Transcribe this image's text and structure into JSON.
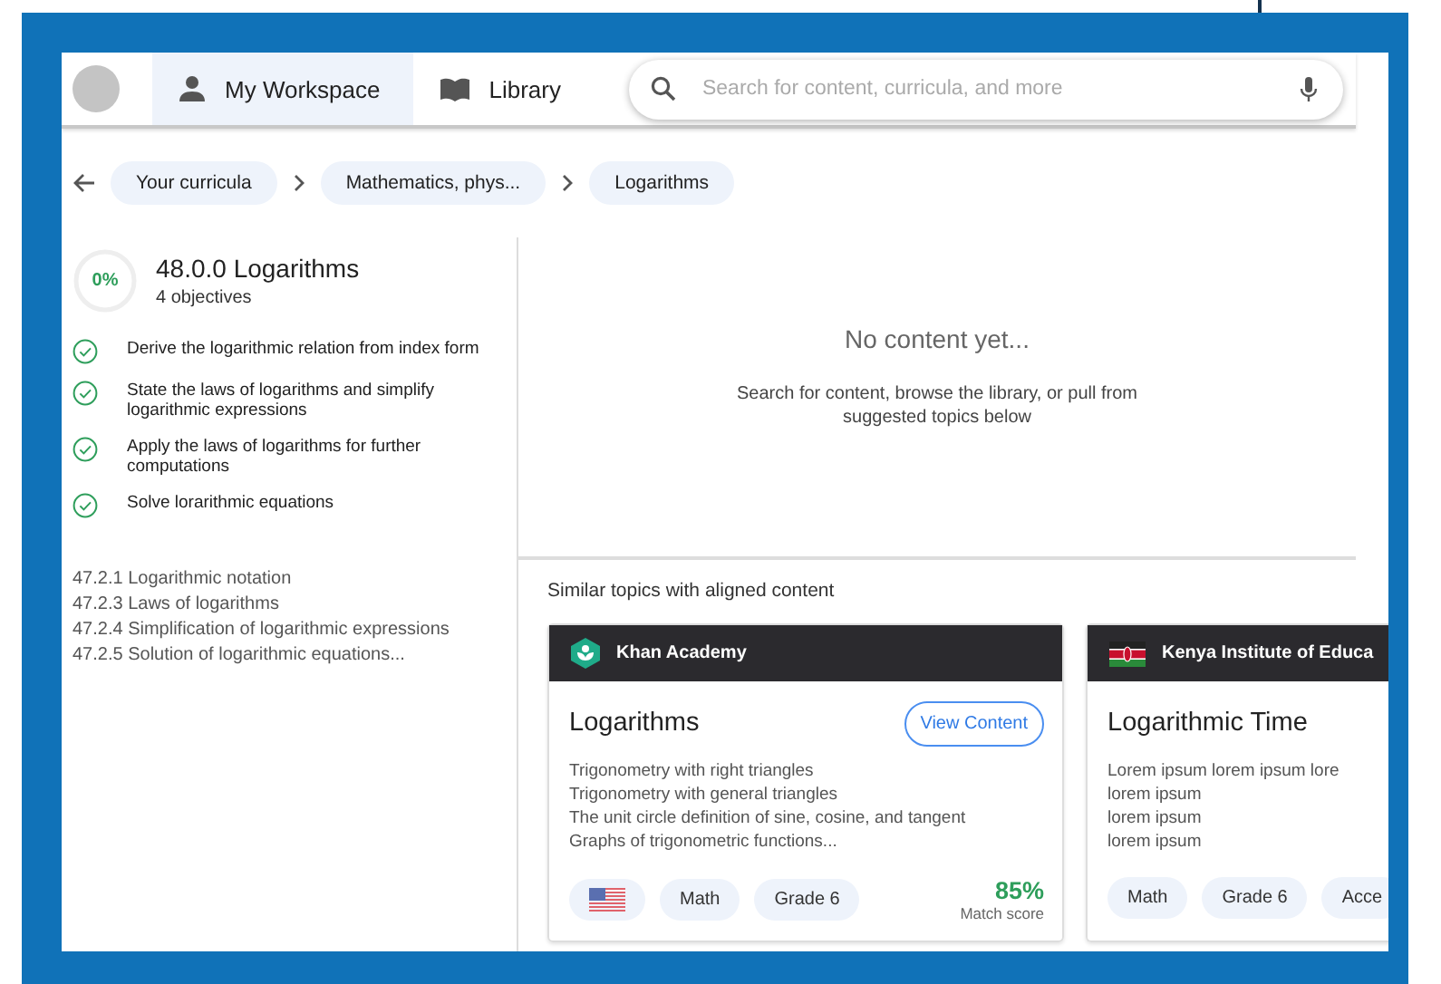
{
  "nav": {
    "tabs": [
      {
        "label": "My Workspace",
        "selected": true
      },
      {
        "label": "Library",
        "selected": false
      }
    ],
    "search": {
      "placeholder": "Search for content, curricula, and more"
    }
  },
  "breadcrumbs": [
    "Your curricula",
    "Mathematics, phys...",
    "Logarithms"
  ],
  "topic": {
    "progress": "0%",
    "title": "48.0.0 Logarithms",
    "subtitle": "4 objectives",
    "objectives": [
      {
        "text": "Derive the logarithmic relation from index form",
        "checked": true
      },
      {
        "text": "State the laws of logarithms and simplify logarithmic expressions",
        "checked": true
      },
      {
        "text": "Apply the laws of logarithms for further computations",
        "checked": true
      },
      {
        "text": "Solve lorarithmic equations",
        "checked": true
      }
    ],
    "subtopics": [
      "47.2.1 Logarithmic notation",
      "47.2.3 Laws of logarithms",
      "47.2.4 Simplification of logarithmic expressions",
      "47.2.5 Solution of logarithmic equations..."
    ]
  },
  "empty_state": {
    "title": "No content yet...",
    "message": "Search for content, browse the library, or pull from suggested topics below"
  },
  "similar": {
    "heading": "Similar topics with aligned content",
    "cards": [
      {
        "provider": "Khan Academy",
        "title": "Logarithms",
        "button": "View Content",
        "lines": [
          "Trigonometry with right triangles",
          "Trigonometry with general triangles",
          "The unit circle definition of sine, cosine, and tangent",
          "Graphs of trigonometric functions..."
        ],
        "tags": [
          {
            "kind": "flag"
          },
          {
            "kind": "text",
            "label": "Math"
          },
          {
            "kind": "text",
            "label": "Grade 6"
          }
        ],
        "score": "85%",
        "score_label": "Match score"
      },
      {
        "provider": "Kenya Institute of Educa",
        "title": "Logarithmic Time",
        "lines": [
          "Lorem ipsum lorem ipsum lore",
          "lorem ipsum",
          "lorem ipsum",
          "lorem ipsum"
        ],
        "tags": [
          {
            "kind": "text",
            "label": "Math"
          },
          {
            "kind": "text",
            "label": "Grade 6"
          },
          {
            "kind": "text",
            "label": "Acce"
          }
        ]
      }
    ]
  }
}
